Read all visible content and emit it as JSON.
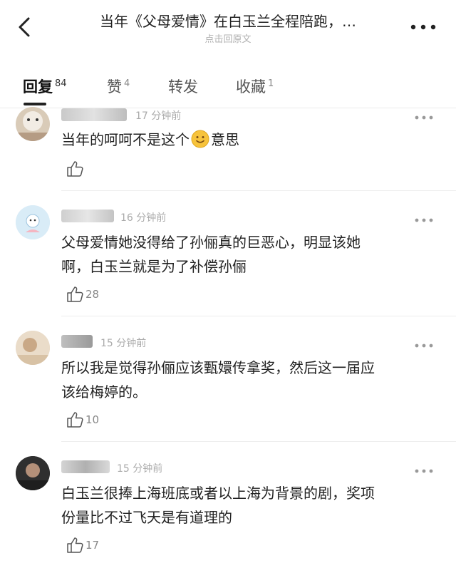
{
  "header": {
    "back_icon": "chevron-left-icon",
    "title": "当年《父母爱情》在白玉兰全程陪跑，…",
    "subtitle": "点击回原文",
    "more_icon": "more-horizontal-icon"
  },
  "tabs": [
    {
      "label": "回复",
      "count": "84",
      "active": true
    },
    {
      "label": "赞",
      "count": "4",
      "active": false
    },
    {
      "label": "转发",
      "count": "",
      "active": false
    },
    {
      "label": "收藏",
      "count": "1",
      "active": false
    }
  ],
  "comments": [
    {
      "time": "17 分钟前",
      "text_before": "当年的呵呵不是这个",
      "emoji": "smile-emoji-icon",
      "text_after": "意思",
      "likes": ""
    },
    {
      "time": "16 分钟前",
      "text_line1": "父母爱情她没得给了孙俪真的巨恶心，明显该她",
      "text_line2": "啊，白玉兰就是为了补偿孙俪",
      "likes": "28"
    },
    {
      "time": "15 分钟前",
      "text_line1": "所以我是觉得孙俪应该甄嬛传拿奖，然后这一届应",
      "text_line2": "该给梅婷的。",
      "likes": "10"
    },
    {
      "time": "15 分钟前",
      "text_line1": "白玉兰很捧上海班底或者以上海为背景的剧，奖项",
      "text_line2": "份量比不过飞天是有道理的",
      "likes": "17"
    }
  ],
  "colors": {
    "text": "#222222",
    "muted": "#aaaaaa",
    "divider": "#eeeeee",
    "emoji": "#f7c33b"
  }
}
